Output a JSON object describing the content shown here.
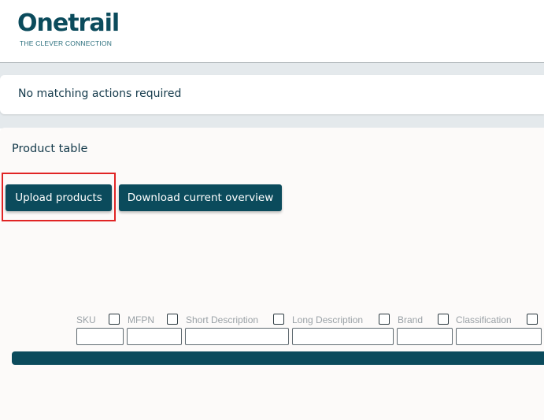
{
  "logo": {
    "name": "Onetrail",
    "tagline": "THE CLEVER CONNECTION"
  },
  "notice": {
    "text": "No matching actions required"
  },
  "product_table": {
    "title": "Product table",
    "upload_label": "Upload products",
    "download_label": "Download current overview",
    "filters": [
      {
        "label": "SKU",
        "value": ""
      },
      {
        "label": "MFPN",
        "value": ""
      },
      {
        "label": "Short Description",
        "value": ""
      },
      {
        "label": "Long Description",
        "value": ""
      },
      {
        "label": "Brand",
        "value": ""
      },
      {
        "label": "Classification",
        "value": ""
      }
    ]
  },
  "colors": {
    "brand": "#0b4b5c",
    "highlight": "#e02424",
    "text": "#13394a"
  }
}
